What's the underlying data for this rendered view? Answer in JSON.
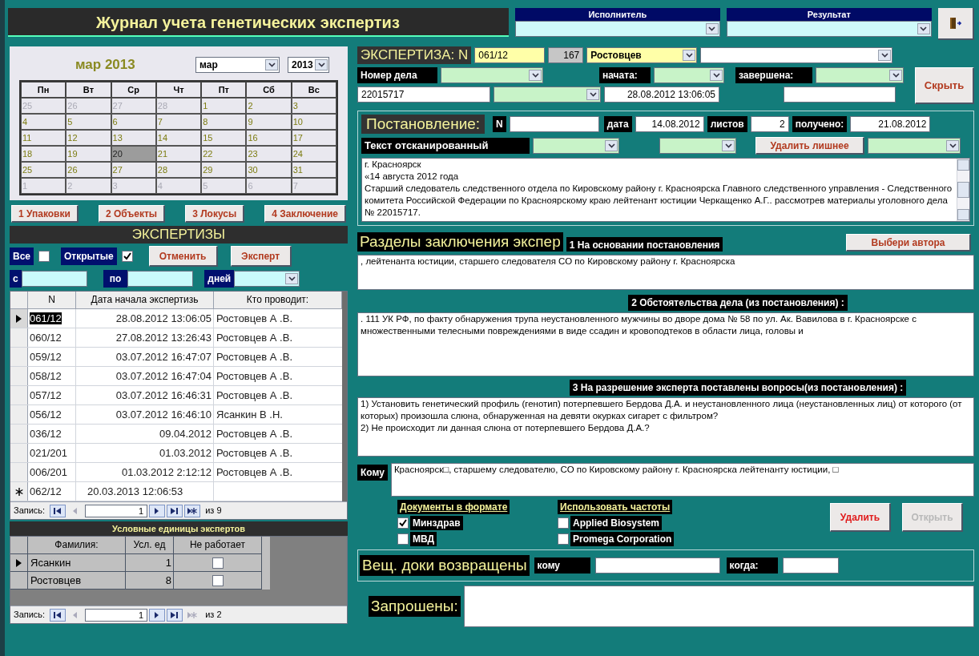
{
  "title": "Журнал учета  генетических экспертиз",
  "header_combos": [
    {
      "label": "Исполнитель"
    },
    {
      "label": "Результат"
    }
  ],
  "calendar": {
    "caption": "мар 2013",
    "month": "мар",
    "year": "2013",
    "weekdays": [
      "Пн",
      "Вт",
      "Ср",
      "Чт",
      "Пт",
      "Сб",
      "Вс"
    ],
    "days": [
      {
        "day": "25",
        "in_month": false,
        "selected": false
      },
      {
        "day": "26",
        "in_month": false,
        "selected": false
      },
      {
        "day": "27",
        "in_month": false,
        "selected": false
      },
      {
        "day": "28",
        "in_month": false,
        "selected": false
      },
      {
        "day": "1",
        "in_month": true,
        "selected": false
      },
      {
        "day": "2",
        "in_month": true,
        "selected": false
      },
      {
        "day": "3",
        "in_month": true,
        "selected": false
      },
      {
        "day": "4",
        "in_month": true,
        "selected": false
      },
      {
        "day": "5",
        "in_month": true,
        "selected": false
      },
      {
        "day": "6",
        "in_month": true,
        "selected": false
      },
      {
        "day": "7",
        "in_month": true,
        "selected": false
      },
      {
        "day": "8",
        "in_month": true,
        "selected": false
      },
      {
        "day": "9",
        "in_month": true,
        "selected": false
      },
      {
        "day": "10",
        "in_month": true,
        "selected": false
      },
      {
        "day": "11",
        "in_month": true,
        "selected": false
      },
      {
        "day": "12",
        "in_month": true,
        "selected": false
      },
      {
        "day": "13",
        "in_month": true,
        "selected": false
      },
      {
        "day": "14",
        "in_month": true,
        "selected": false
      },
      {
        "day": "15",
        "in_month": true,
        "selected": false
      },
      {
        "day": "16",
        "in_month": true,
        "selected": false
      },
      {
        "day": "17",
        "in_month": true,
        "selected": false
      },
      {
        "day": "18",
        "in_month": true,
        "selected": false
      },
      {
        "day": "19",
        "in_month": true,
        "selected": false
      },
      {
        "day": "20",
        "in_month": true,
        "selected": true
      },
      {
        "day": "21",
        "in_month": true,
        "selected": false
      },
      {
        "day": "22",
        "in_month": true,
        "selected": false
      },
      {
        "day": "23",
        "in_month": true,
        "selected": false
      },
      {
        "day": "24",
        "in_month": true,
        "selected": false
      },
      {
        "day": "25",
        "in_month": true,
        "selected": false
      },
      {
        "day": "26",
        "in_month": true,
        "selected": false
      },
      {
        "day": "27",
        "in_month": true,
        "selected": false
      },
      {
        "day": "28",
        "in_month": true,
        "selected": false
      },
      {
        "day": "29",
        "in_month": true,
        "selected": false
      },
      {
        "day": "30",
        "in_month": true,
        "selected": false
      },
      {
        "day": "31",
        "in_month": true,
        "selected": false
      },
      {
        "day": "1",
        "in_month": false,
        "selected": false
      },
      {
        "day": "2",
        "in_month": false,
        "selected": false
      },
      {
        "day": "3",
        "in_month": false,
        "selected": false
      },
      {
        "day": "4",
        "in_month": false,
        "selected": false
      },
      {
        "day": "5",
        "in_month": false,
        "selected": false
      },
      {
        "day": "6",
        "in_month": false,
        "selected": false
      },
      {
        "day": "7",
        "in_month": false,
        "selected": false
      }
    ]
  },
  "tab_buttons": [
    "1 Упаковки",
    "2 Объекты",
    "3 Локусы",
    "4 Заключение"
  ],
  "list_title": "ЭКСПЕРТИЗЫ",
  "filters": {
    "all": {
      "label": "Все",
      "checked": false
    },
    "open": {
      "label": "Открытые",
      "checked": true
    },
    "buttons": [
      "Отменить",
      "Эксперт"
    ],
    "from_label": "с",
    "to_label": "по",
    "days_label": "дней"
  },
  "expertises": {
    "columns": [
      "N",
      "Дата начала экспертизь",
      "Кто проводит:"
    ],
    "rows": [
      {
        "n": "061/12",
        "date": "28.08.2012 13:06:05",
        "who": "Ростовцев А .В.",
        "selected": true,
        "kind": "record"
      },
      {
        "n": "060/12",
        "date": "27.08.2012 13:26:43",
        "who": "Ростовцев А .В.",
        "selected": false,
        "kind": "record"
      },
      {
        "n": "059/12",
        "date": "03.07.2012 16:47:07",
        "who": "Ростовцев А .В.",
        "selected": false,
        "kind": "record"
      },
      {
        "n": "058/12",
        "date": "03.07.2012 16:47:04",
        "who": "Ростовцев А .В.",
        "selected": false,
        "kind": "record"
      },
      {
        "n": "057/12",
        "date": "03.07.2012 16:46:31",
        "who": "Ростовцев А .В.",
        "selected": false,
        "kind": "record"
      },
      {
        "n": "056/12",
        "date": "03.07.2012 16:46:10",
        "who": "Ясанкин В .Н.",
        "selected": false,
        "kind": "record"
      },
      {
        "n": "036/12",
        "date": "09.04.2012",
        "who": "Ростовцев А .В.",
        "selected": false,
        "kind": "record"
      },
      {
        "n": "021/201",
        "date": "01.03.2012",
        "who": "Ростовцев А .В.",
        "selected": false,
        "kind": "record"
      },
      {
        "n": "006/201",
        "date": "01.03.2012 2:12:12",
        "who": "Ростовцев А .В.",
        "selected": false,
        "kind": "record"
      },
      {
        "n": "062/12",
        "date": "20.03.2013 12:06:53",
        "selected": false,
        "kind": "new"
      }
    ],
    "nav": {
      "label": "Запись:",
      "current": "1",
      "total": "из 9",
      "new_enabled": true
    }
  },
  "units": {
    "title": "Условные единицы экспертов",
    "columns": [
      "Фамилия:",
      "Усл. ед",
      "Не работает"
    ],
    "rows": [
      {
        "name": "Ясанкин",
        "units": "1",
        "not_working": false,
        "selected": true
      },
      {
        "name": "Ростовцев",
        "units": "8",
        "not_working": false,
        "selected": false
      }
    ],
    "nav": {
      "label": "Запись:",
      "current": "1",
      "total": "из 2",
      "new_enabled": false
    }
  },
  "expertise": {
    "label": "ЭКСПЕРТИЗА: N",
    "number": "061/12",
    "code": "167",
    "expert": "Ростовцев",
    "case_label": "Номер дела",
    "case_number": "22015717",
    "started_label": "начата:",
    "started": "28.08.2012 13:06:05",
    "finished_label": "завершена:",
    "hide_button": "Скрыть"
  },
  "resolution": {
    "label": "Постановление:",
    "n_label": "N",
    "date_label": "дата",
    "date": "14.08.2012",
    "sheets_label": "листов",
    "sheets": "2",
    "received_label": "получено:",
    "received": "21.08.2012",
    "scan_label": "Текст отсканированный",
    "remove_button": "Удалить лишнее",
    "scan_text": "г. Красноярск\n«14  августа 2012 года\nСтарший следователь следственного отдела по Кировскому району г. Красноярска Главного следственного управления - Следственного комитета Российской Федерации по Красноярскому краю лейтенант юстиции Черкащенко А.Г.. рассмотрев материалы уголовного дела № 22015717."
  },
  "sections": {
    "title": "Разделы заключения экспер",
    "author_button": "Выбери автора",
    "items": [
      {
        "label": "1 На основании постановления",
        "text": ", лейтенанта юстиции, старшего следователя СО по Кировскому району г. Красноярска"
      },
      {
        "label": "2 Обстоятельства дела (из постановления) :",
        "text": ". 111 УК РФ, по факту обнаружения трупа неустановленного мужчины во дворе дома № 58 по ул. Ак. Вавилова в г. Красноярске с множественными телесными повреждениями в виде ссадин и кровоподтеков в области лица, головы и"
      },
      {
        "label": "3 На разрешение эксперта поставлены вопросы(из постановления) :",
        "text": "1) Установить генетический профиль (генотип) потерпевшего Бердова Д.А. и неустановленного лица (неустановленных лиц) от которого (от которых) произошла слюна, обнаруженная на девяти окурках сигарет с фильтром?\n2) Не происходит ли данная слюна от потерпевшего Бердова Д.А.?"
      }
    ]
  },
  "recipient": {
    "label": "Кому",
    "text": "Красноярск□, старшему следователю, СО по Кировскому району г. Красноярска   лейтенанту юстиции, □"
  },
  "options": [
    {
      "title": "Документы в формате",
      "items": [
        {
          "label": "Минздрав",
          "checked": true
        },
        {
          "label": "МВД",
          "checked": false
        }
      ]
    },
    {
      "title": "Использовать частоты",
      "items": [
        {
          "label": "Applied Biosystem",
          "checked": false
        },
        {
          "label": "Promega Corporation",
          "checked": false
        }
      ]
    }
  ],
  "actions": [
    {
      "label": "Удалить",
      "disabled": false
    },
    {
      "label": "Открыть",
      "disabled": true
    }
  ],
  "returned": {
    "label": "Вещ. доки возвращены",
    "to_label": "кому",
    "when_label": "когда:"
  },
  "requested": {
    "label": "Запрошены:"
  }
}
